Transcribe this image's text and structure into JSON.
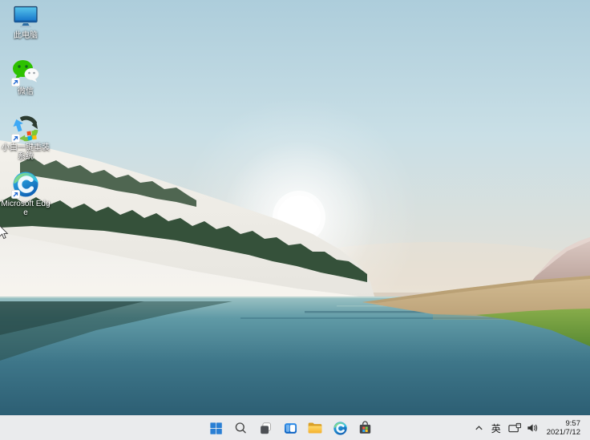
{
  "desktop_icons": [
    {
      "id": "this-pc",
      "label": "此电脑",
      "shortcut": false
    },
    {
      "id": "wechat",
      "label": "微信",
      "shortcut": true
    },
    {
      "id": "xiaobai-reinstall",
      "label": "小白一键重装系统",
      "shortcut": true
    },
    {
      "id": "microsoft-edge",
      "label": "Microsoft Edge",
      "shortcut": true
    }
  ],
  "taskbar": {
    "buttons": [
      {
        "icon": "windows-start-icon"
      },
      {
        "icon": "search-icon"
      },
      {
        "icon": "task-view-icon"
      },
      {
        "icon": "widgets-icon"
      },
      {
        "icon": "file-explorer-icon"
      },
      {
        "icon": "edge-icon"
      },
      {
        "icon": "microsoft-store-icon"
      }
    ],
    "tray": {
      "chevron_icon": "chevron-up-icon",
      "ime_label": "英",
      "icons": [
        "network-icon",
        "volume-icon"
      ],
      "clock": {
        "time": "9:57",
        "date": "2021/7/12"
      }
    }
  },
  "colors": {
    "taskbar_bg": "#f2f3f5",
    "start_blue": "#2a7fd4",
    "sky_top": "#adcddb",
    "sky_horizon": "#e8e2d8",
    "water_mid": "#3e7689",
    "water_deep": "#2c5e73",
    "tree_green": "#35513a",
    "reed_tan": "#c7af85",
    "grass_green": "#6d9c3e",
    "mountain_pink": "#c4aba6"
  }
}
